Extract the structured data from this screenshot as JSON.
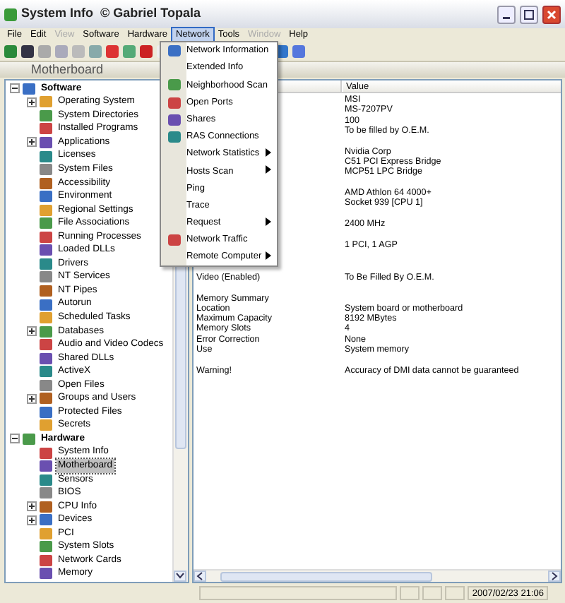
{
  "window": {
    "title": "System Info  © Gabriel Topala"
  },
  "menu_bar": [
    {
      "label": "File",
      "disabled": false,
      "selected": false
    },
    {
      "label": "Edit",
      "disabled": false,
      "selected": false
    },
    {
      "label": "View",
      "disabled": true,
      "selected": false
    },
    {
      "label": "Software",
      "disabled": false,
      "selected": false
    },
    {
      "label": "Hardware",
      "disabled": false,
      "selected": false
    },
    {
      "label": "Network",
      "disabled": false,
      "selected": true
    },
    {
      "label": "Tools",
      "disabled": false,
      "selected": false
    },
    {
      "label": "Window",
      "disabled": true,
      "selected": false
    },
    {
      "label": "Help",
      "disabled": false,
      "selected": false
    }
  ],
  "open_menu": {
    "items": [
      {
        "label": "Network Information",
        "has_icon": true,
        "has_submenu": false
      },
      {
        "label": "Extended Info",
        "has_icon": false,
        "has_submenu": false
      },
      {
        "label": "Neighborhood Scan",
        "has_icon": true,
        "has_submenu": false
      },
      {
        "label": "Open Ports",
        "has_icon": true,
        "has_submenu": false
      },
      {
        "label": "Shares",
        "has_icon": true,
        "has_submenu": false
      },
      {
        "label": "RAS Connections",
        "has_icon": true,
        "has_submenu": false
      },
      {
        "label": "Network Statistics",
        "has_icon": false,
        "has_submenu": true
      },
      {
        "label": "Hosts Scan",
        "has_icon": false,
        "has_submenu": true
      },
      {
        "label": "Ping",
        "has_icon": false,
        "has_submenu": false
      },
      {
        "label": "Trace",
        "has_icon": false,
        "has_submenu": false
      },
      {
        "label": "Request",
        "has_icon": false,
        "has_submenu": true
      },
      {
        "label": "Network Traffic",
        "has_icon": true,
        "has_submenu": false
      },
      {
        "label": "Remote Computer",
        "has_icon": false,
        "has_submenu": true
      }
    ]
  },
  "header": {
    "title": "Motherboard"
  },
  "tree": [
    {
      "label": "Software",
      "expanded": true,
      "selected": false,
      "children": [
        {
          "label": "Operating System",
          "expanded": false,
          "selected": false
        },
        {
          "label": "System Directories",
          "selected": false
        },
        {
          "label": "Installed Programs",
          "selected": false
        },
        {
          "label": "Applications",
          "expanded": false,
          "selected": false
        },
        {
          "label": "Licenses",
          "selected": false
        },
        {
          "label": "System Files",
          "selected": false
        },
        {
          "label": "Accessibility",
          "selected": false
        },
        {
          "label": "Environment",
          "selected": false
        },
        {
          "label": "Regional Settings",
          "selected": false
        },
        {
          "label": "File Associations",
          "selected": false
        },
        {
          "label": "Running Processes",
          "selected": false
        },
        {
          "label": "Loaded DLLs",
          "selected": false
        },
        {
          "label": "Drivers",
          "selected": false
        },
        {
          "label": "NT Services",
          "selected": false
        },
        {
          "label": "NT Pipes",
          "selected": false
        },
        {
          "label": "Autorun",
          "selected": false
        },
        {
          "label": "Scheduled Tasks",
          "selected": false
        },
        {
          "label": "Databases",
          "expanded": false,
          "selected": false
        },
        {
          "label": "Audio and Video Codecs",
          "selected": false
        },
        {
          "label": "Shared DLLs",
          "selected": false
        },
        {
          "label": "ActiveX",
          "selected": false
        },
        {
          "label": "Open Files",
          "selected": false
        },
        {
          "label": "Groups and Users",
          "expanded": false,
          "selected": false
        },
        {
          "label": "Protected Files",
          "selected": false
        },
        {
          "label": "Secrets",
          "selected": false
        }
      ]
    },
    {
      "label": "Hardware",
      "expanded": true,
      "selected": false,
      "children": [
        {
          "label": "System Info",
          "selected": false
        },
        {
          "label": "Motherboard",
          "selected": true
        },
        {
          "label": "Sensors",
          "selected": false
        },
        {
          "label": "BIOS",
          "selected": false
        },
        {
          "label": "CPU Info",
          "expanded": false,
          "selected": false
        },
        {
          "label": "Devices",
          "expanded": false,
          "selected": false
        },
        {
          "label": "PCI",
          "selected": false
        },
        {
          "label": "System Slots",
          "selected": false
        },
        {
          "label": "Network Cards",
          "selected": false
        },
        {
          "label": "Memory",
          "selected": false
        }
      ]
    }
  ],
  "details": {
    "value_header": "Value",
    "groups": [
      [
        {
          "value": "MSI"
        },
        {
          "value": "MS-7207PV"
        },
        {
          "value": "100"
        },
        {
          "value": "To be filled by O.E.M."
        }
      ],
      [
        {
          "value": "Nvidia Corp"
        },
        {
          "value": "C51 PCI Express Bridge"
        },
        {
          "value": "MCP51 LPC Bridge"
        }
      ],
      [
        {
          "value": "AMD Athlon 64 4000+"
        },
        {
          "value": "Socket 939 [CPU 1]"
        }
      ],
      [
        {
          "value": "2400 MHz"
        }
      ],
      [
        {
          "value": "1 PCI, 1 AGP"
        }
      ],
      [
        {
          "label": "Video (Enabled)",
          "value": "To Be Filled By O.E.M."
        }
      ],
      [
        {
          "label": "Memory Summary"
        },
        {
          "label": "Location",
          "value": "System board or motherboard"
        },
        {
          "label": "Maximum Capacity",
          "value": "8192 MBytes"
        },
        {
          "label": "Memory Slots",
          "value": "4"
        },
        {
          "label": "Error Correction",
          "value": "None"
        },
        {
          "label": "Use",
          "value": "System memory"
        }
      ],
      [
        {
          "label": "Warning!",
          "value": "Accuracy of DMI data cannot be guaranteed"
        }
      ]
    ]
  },
  "status_bar": {
    "time": "2007/02/23 21:06"
  }
}
